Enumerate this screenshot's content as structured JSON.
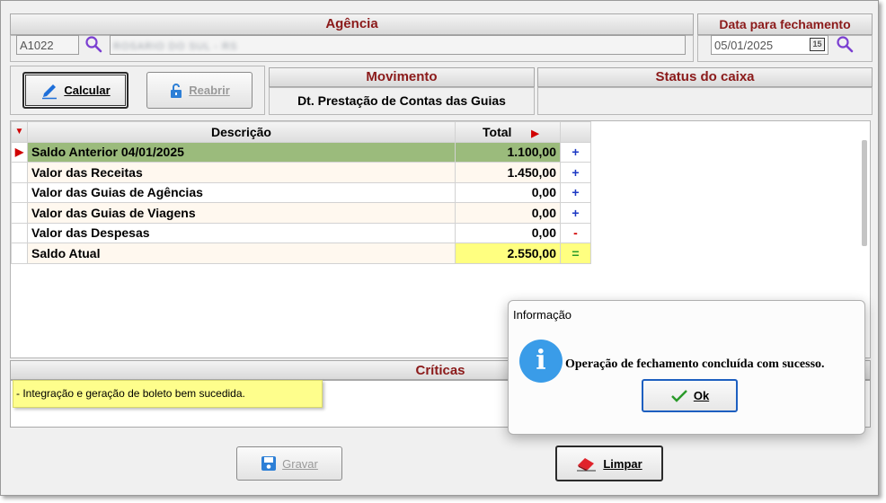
{
  "agencia": {
    "header": "Agência",
    "code": "A1022",
    "name": "ROSARIO DO SUL - RS"
  },
  "data_fechamento": {
    "header": "Data para fechamento",
    "value": "05/01/2025",
    "calendar_icon": "calendar-icon"
  },
  "buttons": {
    "calcular": "Calcular",
    "reabrir": "Reabrir",
    "gravar": "Gravar",
    "limpar": "Limpar"
  },
  "movimento": {
    "header": "Movimento",
    "value": "Dt. Prestação de Contas das Guias"
  },
  "status_caixa": {
    "header": "Status do caixa",
    "value": ""
  },
  "grid": {
    "col_descricao": "Descrição",
    "col_total": "Total",
    "rows": [
      {
        "desc": "Saldo Anterior  04/01/2025",
        "total": "1.100,00",
        "sign": "+"
      },
      {
        "desc": "Valor das Receitas",
        "total": "1.450,00",
        "sign": "+"
      },
      {
        "desc": "Valor das Guias de Agências",
        "total": "0,00",
        "sign": "+"
      },
      {
        "desc": "Valor das Guias de Viagens",
        "total": "0,00",
        "sign": "+"
      },
      {
        "desc": "Valor das Despesas",
        "total": "0,00",
        "sign": "-"
      },
      {
        "desc": "Saldo Atual",
        "total": "2.550,00",
        "sign": "="
      }
    ]
  },
  "criticas": {
    "header": "Críticas",
    "message": "- Integração e geração de boleto bem sucedida."
  },
  "dialog": {
    "title": "Informação",
    "message": "Operação de fechamento concluída com sucesso.",
    "ok": "Ok"
  },
  "colors": {
    "header_text": "#8b1a1a",
    "selected_row": "#9bbb7c",
    "saldo_highlight": "#ffff80",
    "plus": "#1d39c4",
    "minus": "#d00000",
    "equals": "#2a9a2a"
  }
}
